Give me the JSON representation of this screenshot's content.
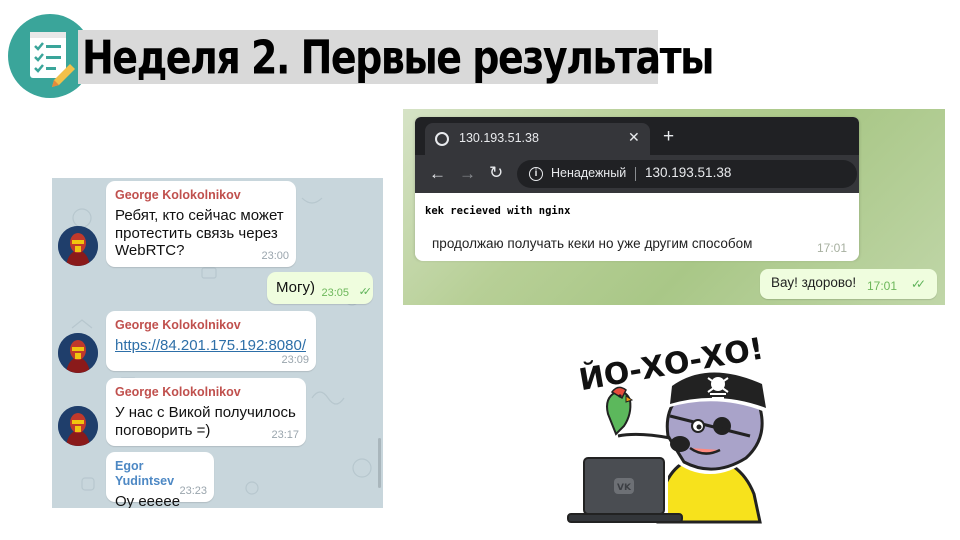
{
  "slide": {
    "title": "Неделя 2. Первые результаты"
  },
  "telegram_chat": {
    "messages": [
      {
        "sender": "George Kolokolnikov",
        "text": "Ребят, кто сейчас может\nпротестить связь через\nWebRTC?",
        "time": "23:00",
        "direction": "in"
      },
      {
        "sender": "",
        "text": "Могу)",
        "time": "23:05",
        "direction": "out"
      },
      {
        "sender": "George Kolokolnikov",
        "link": "https://84.201.175.192:8080/",
        "time": "23:09",
        "direction": "in"
      },
      {
        "sender": "George Kolokolnikov",
        "text": "У нас с Викой получилось\nпоговорить =)",
        "time": "23:17",
        "direction": "in"
      },
      {
        "sender": "Egor Yudintsev",
        "text": "Оу ееееe",
        "time": "23:23",
        "direction": "in"
      }
    ]
  },
  "browser_chat": {
    "tab_title": "130.193.51.38",
    "security_label": "Ненадежный",
    "address": "130.193.51.38",
    "page_text": "kek recieved with nginx",
    "incoming": {
      "text": "продолжаю получать кеки но уже другим способом",
      "time": "17:01"
    },
    "outgoing": {
      "text": "Вау! здорово!",
      "time": "17:01"
    }
  },
  "sticker": {
    "caption": "ЙО-ХО-ХО!",
    "laptop_logo": "VK"
  },
  "colors": {
    "title_bar": "#d9d9d9",
    "icon_circle": "#3aa59a",
    "chat_background": "#c8d6dc",
    "sender_name": "#c0504d",
    "sender_name_alt": "#4d88c4",
    "outgoing_bubble": "#effdde",
    "link": "#2d6fa8"
  }
}
